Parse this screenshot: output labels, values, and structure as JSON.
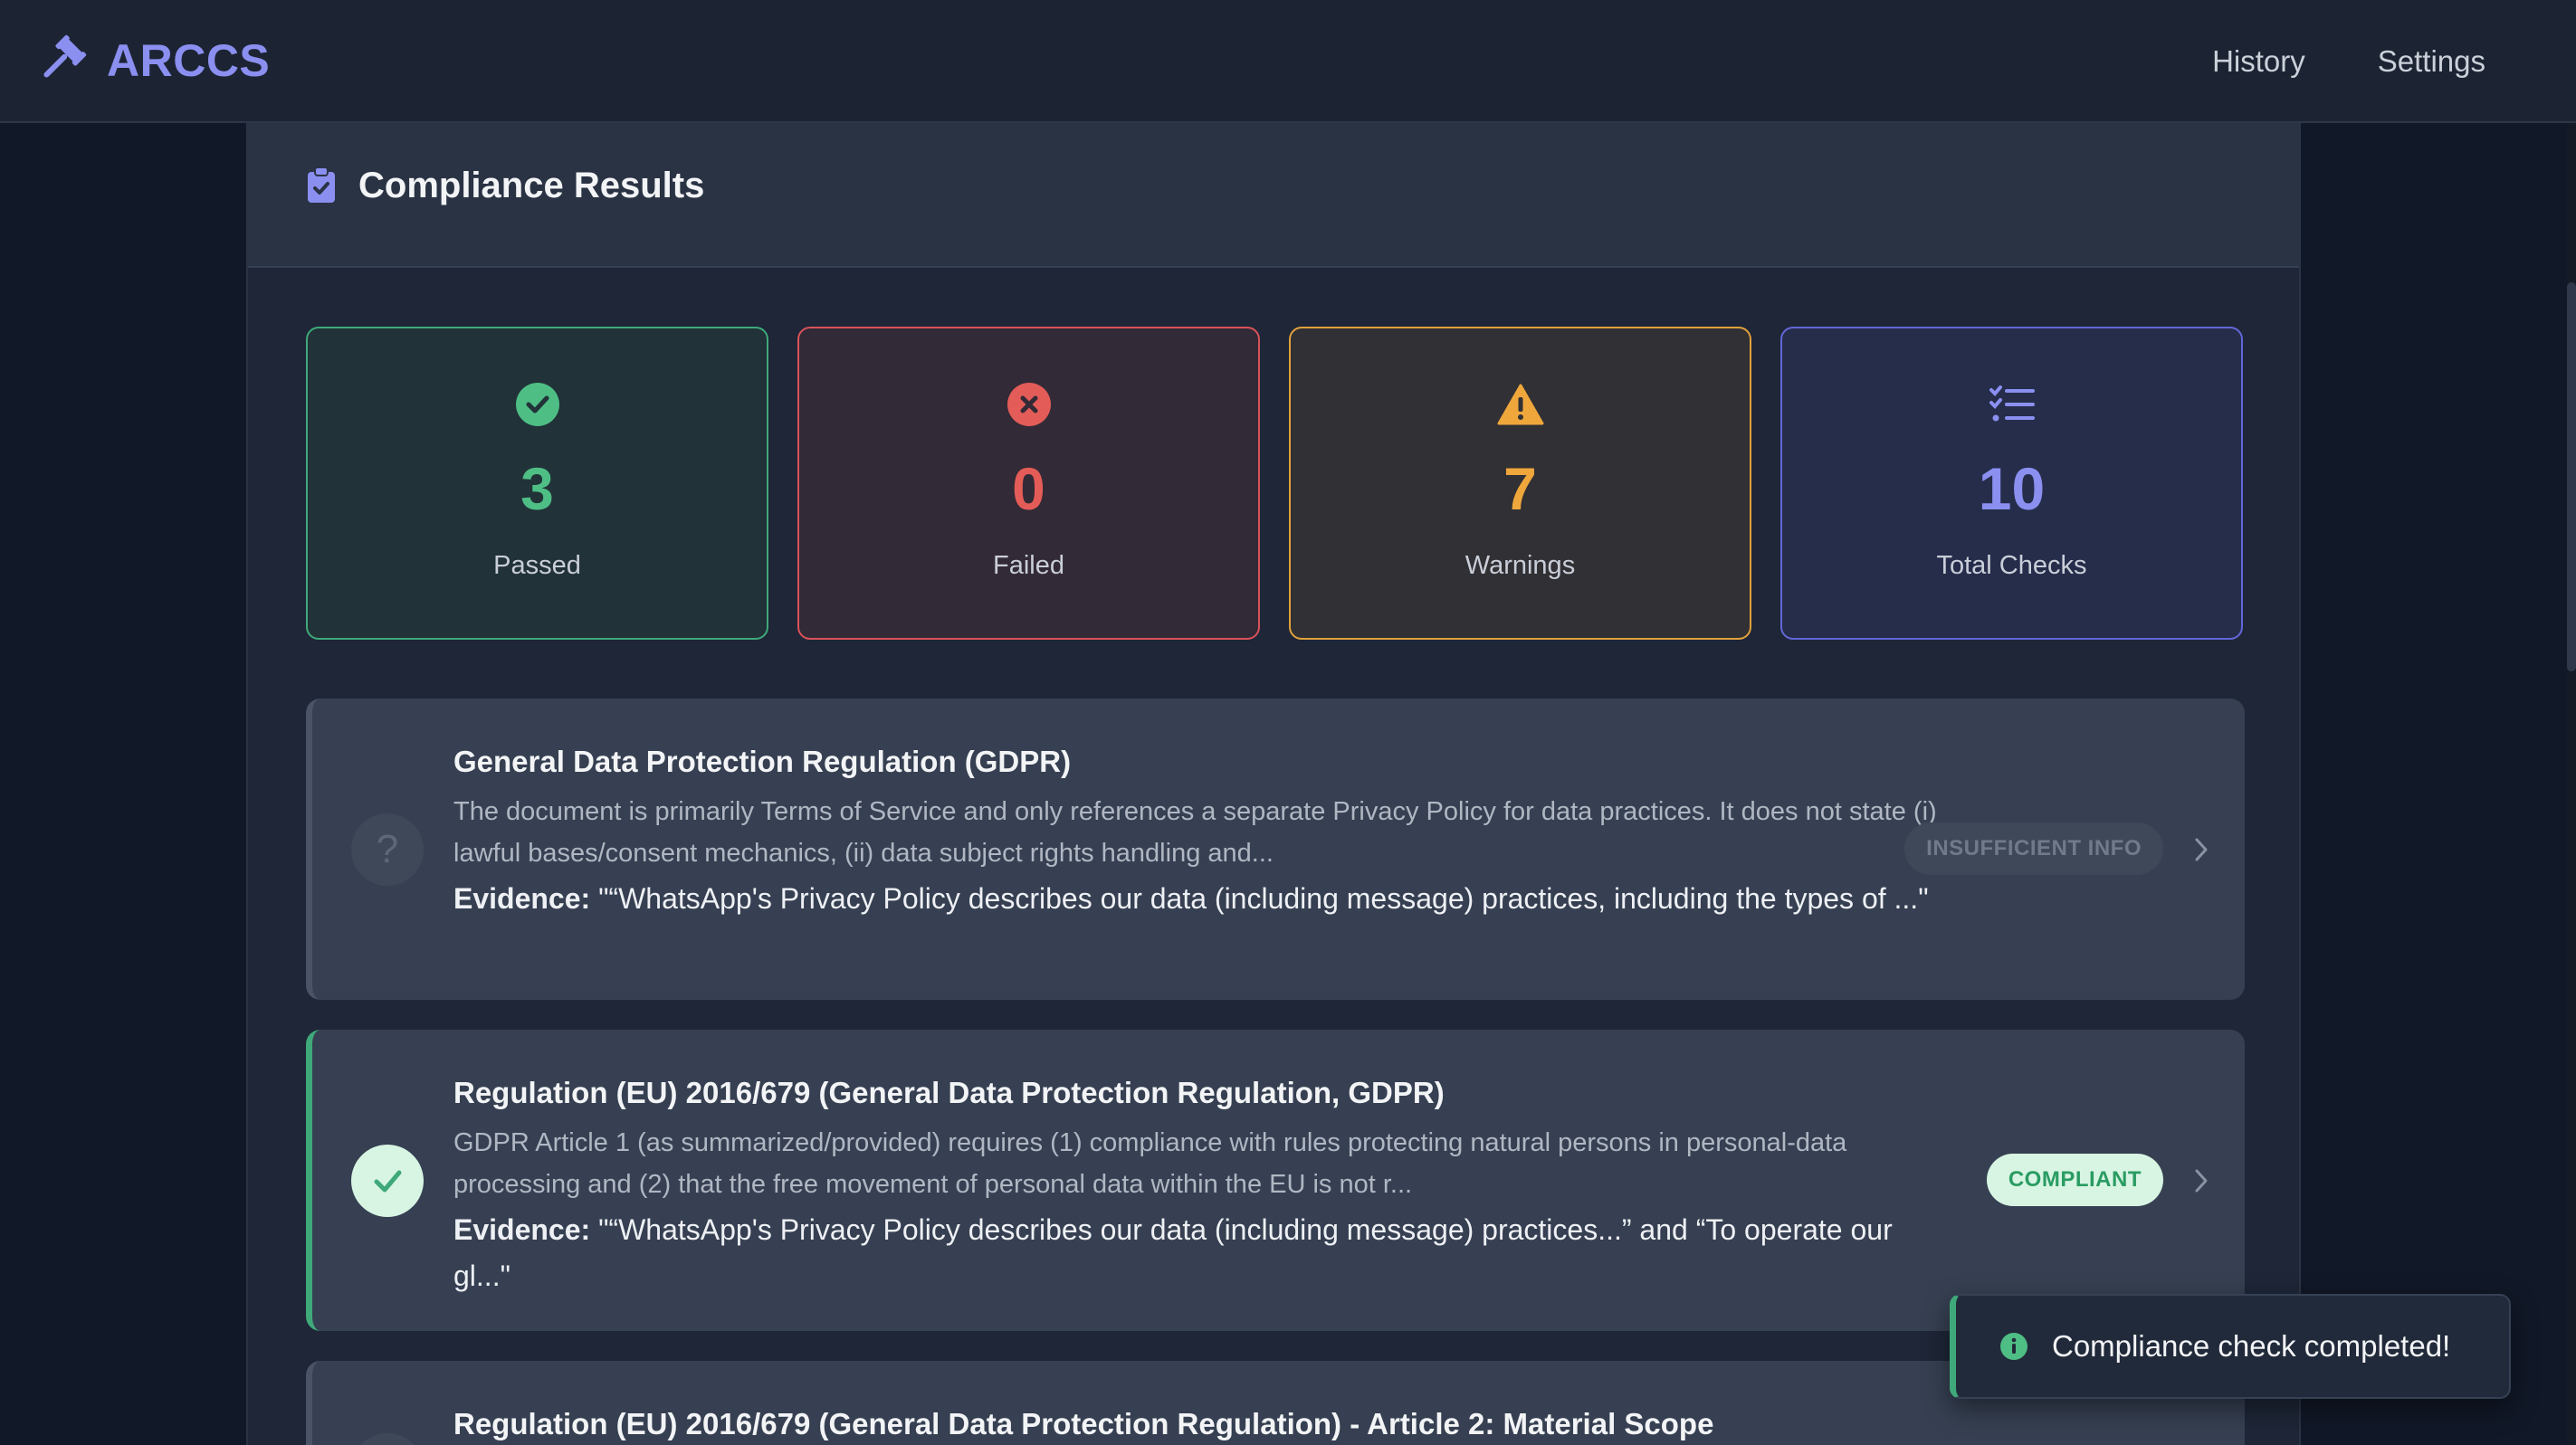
{
  "app": {
    "name": "ARCCS"
  },
  "nav": {
    "history": "History",
    "settings": "Settings"
  },
  "panel": {
    "title": "Compliance Results"
  },
  "stats": [
    {
      "value": "3",
      "label": "Passed",
      "icon": "check-circle-icon",
      "color": "#4ebe85"
    },
    {
      "value": "0",
      "label": "Failed",
      "icon": "x-circle-icon",
      "color": "#e45c58"
    },
    {
      "value": "7",
      "label": "Warnings",
      "icon": "warning-icon",
      "color": "#efa73c"
    },
    {
      "value": "10",
      "label": "Total Checks",
      "icon": "checklist-icon",
      "color": "#8b8ff0"
    }
  ],
  "results": [
    {
      "title": "General Data Protection Regulation (GDPR)",
      "description": "The document is primarily Terms of Service and only references a separate Privacy Policy for data practices. It does not state (i) lawful bases/consent mechanics, (ii) data subject rights handling and...",
      "evidence_label": "Evidence:",
      "evidence": " \"“WhatsApp's Privacy Policy describes our data (including message) practices, including the types of ...\"",
      "status": "INSUFFICIENT INFO",
      "icon": "question-icon"
    },
    {
      "title": "Regulation (EU) 2016/679 (General Data Protection Regulation, GDPR)",
      "description": "GDPR Article 1 (as summarized/provided) requires (1) compliance with rules protecting natural persons in personal-data processing and (2) that the free movement of personal data within the EU is not r...",
      "evidence_label": "Evidence:",
      "evidence": " \"“WhatsApp's Privacy Policy describes our data (including message) practices...” and “To operate our gl...\"",
      "status": "COMPLIANT",
      "icon": "check-icon"
    },
    {
      "title": "Regulation (EU) 2016/679 (General Data Protection Regulation) - Article 2: Material Scope"
    }
  ],
  "toast": {
    "message": "Compliance check completed!",
    "icon": "info-icon"
  },
  "colors": {
    "accent": "#8b8ff0",
    "pass": "#4ebe85",
    "fail": "#e45c58",
    "warn": "#efa73c"
  }
}
